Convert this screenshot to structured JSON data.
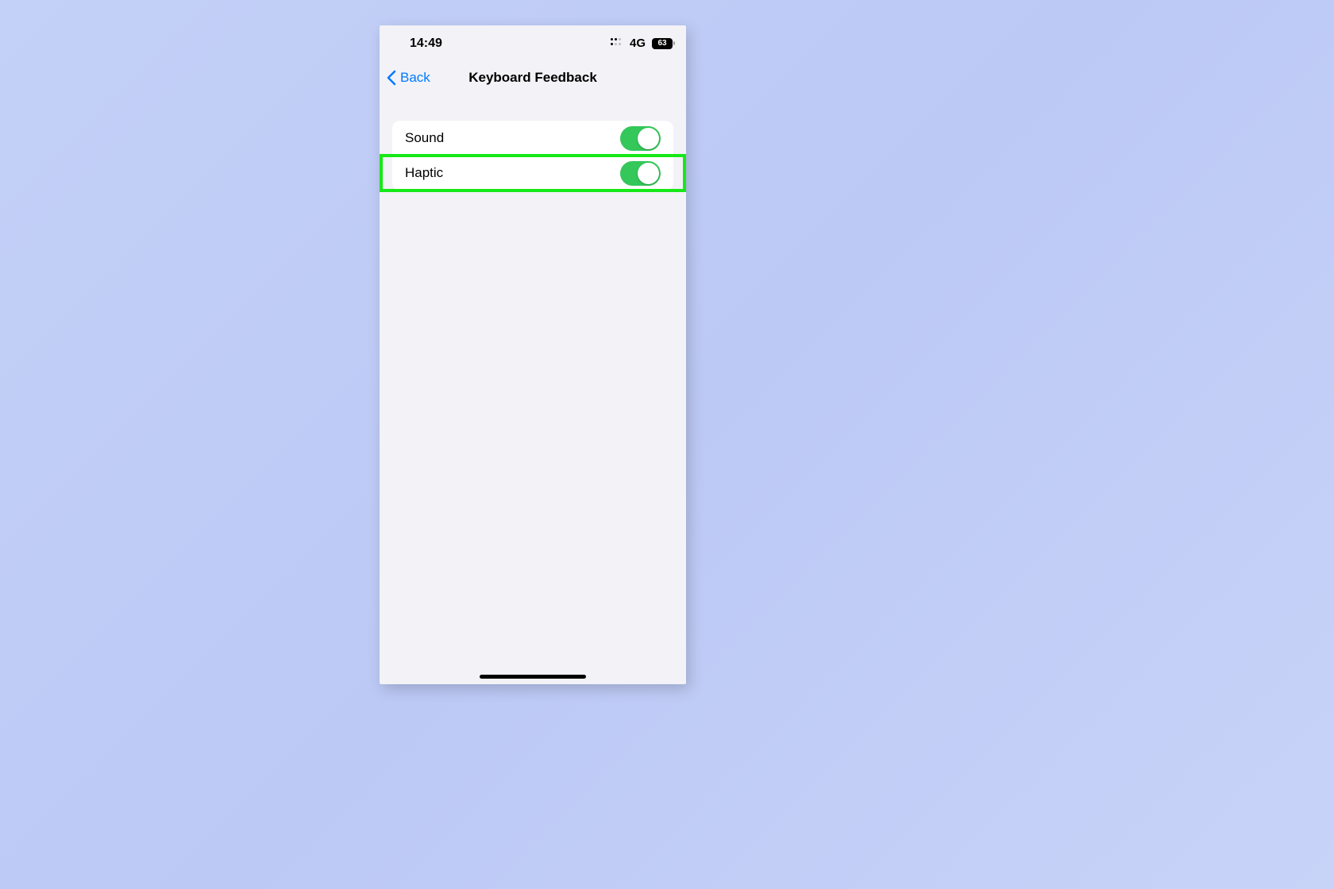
{
  "status": {
    "time": "14:49",
    "network": "4G",
    "battery": "63"
  },
  "nav": {
    "back_label": "Back",
    "title": "Keyboard Feedback"
  },
  "settings": {
    "rows": [
      {
        "label": "Sound",
        "on": true
      },
      {
        "label": "Haptic",
        "on": true
      }
    ]
  },
  "annotation": {
    "highlight_row_index": 1,
    "highlight_color": "#17e817"
  }
}
